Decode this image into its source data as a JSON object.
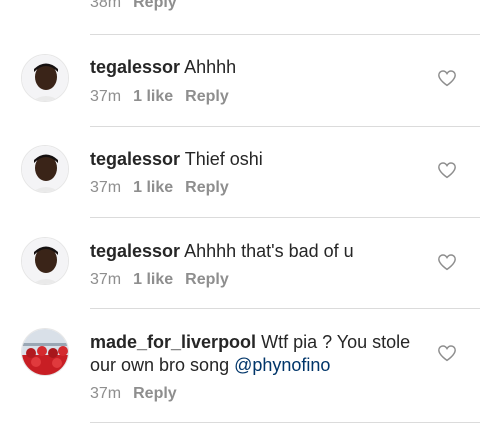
{
  "top_partial": {
    "time": "38m",
    "reply_label": "Reply"
  },
  "comments": [
    {
      "username": "tegalessor",
      "text": "Ahhhh",
      "mention": "",
      "time": "37m",
      "likes": "1 like",
      "reply_label": "Reply",
      "avatar": "person-avatar"
    },
    {
      "username": "tegalessor",
      "text": "Thief oshi",
      "mention": "",
      "time": "37m",
      "likes": "1 like",
      "reply_label": "Reply",
      "avatar": "person-avatar"
    },
    {
      "username": "tegalessor",
      "text": "Ahhhh that's bad of u",
      "mention": "",
      "time": "37m",
      "likes": "1 like",
      "reply_label": "Reply",
      "avatar": "person-avatar"
    },
    {
      "username": "made_for_liverpool",
      "text": "Wtf pia ? You stole our own bro song",
      "mention": "@phynofino",
      "time": "37m",
      "likes": "",
      "reply_label": "Reply",
      "avatar": "crowd-avatar"
    }
  ],
  "colors": {
    "text": "#262626",
    "muted": "#8e8e8e",
    "mention": "#003569",
    "divider": "#dbdbdb"
  },
  "icons": {
    "like": "heart-outline-icon"
  }
}
